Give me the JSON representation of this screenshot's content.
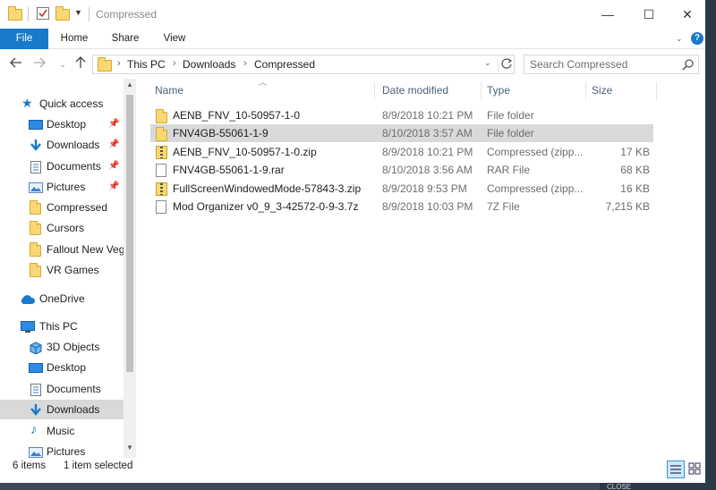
{
  "window": {
    "title": "Compressed",
    "controls": {
      "minimize": "—",
      "maximize": "☐",
      "close": "✕"
    }
  },
  "ribbon": {
    "tabs": [
      "File",
      "Home",
      "Share",
      "View"
    ],
    "help": "?"
  },
  "address": {
    "crumbs": [
      "This PC",
      "Downloads",
      "Compressed"
    ],
    "search_placeholder": "Search Compressed"
  },
  "sidebar": {
    "items": [
      {
        "label": "Quick access",
        "icon": "star-icon",
        "pinned": false
      },
      {
        "label": "Desktop",
        "icon": "desktop-icon",
        "pinned": true
      },
      {
        "label": "Downloads",
        "icon": "download-arrow-icon",
        "pinned": true
      },
      {
        "label": "Documents",
        "icon": "documents-icon",
        "pinned": true
      },
      {
        "label": "Pictures",
        "icon": "pictures-icon",
        "pinned": true
      },
      {
        "label": "Compressed",
        "icon": "folder-icon",
        "pinned": false
      },
      {
        "label": "Cursors",
        "icon": "folder-icon",
        "pinned": false
      },
      {
        "label": "Fallout New Veg",
        "icon": "folder-icon",
        "pinned": false
      },
      {
        "label": "VR Games",
        "icon": "folder-icon",
        "pinned": false
      },
      {
        "label": "OneDrive",
        "icon": "cloud-icon",
        "pinned": false
      },
      {
        "label": "This PC",
        "icon": "computer-icon",
        "pinned": false
      },
      {
        "label": "3D Objects",
        "icon": "cube-icon",
        "pinned": false
      },
      {
        "label": "Desktop",
        "icon": "desktop-icon",
        "pinned": false
      },
      {
        "label": "Documents",
        "icon": "documents-icon",
        "pinned": false
      },
      {
        "label": "Downloads",
        "icon": "download-arrow-icon",
        "pinned": false
      },
      {
        "label": "Music",
        "icon": "music-note-icon",
        "pinned": false
      },
      {
        "label": "Pictures",
        "icon": "pictures-icon",
        "pinned": false
      }
    ]
  },
  "files": {
    "columns": [
      "Name",
      "Date modified",
      "Type",
      "Size"
    ],
    "rows": [
      {
        "name": "AENB_FNV_10-50957-1-0",
        "date": "8/9/2018 10:21 PM",
        "type": "File folder",
        "size": "",
        "icon": "folder-icon"
      },
      {
        "name": "FNV4GB-55061-1-9",
        "date": "8/10/2018 3:57 AM",
        "type": "File folder",
        "size": "",
        "icon": "folder-icon"
      },
      {
        "name": "AENB_FNV_10-50957-1-0.zip",
        "date": "8/9/2018 10:21 PM",
        "type": "Compressed (zipp...",
        "size": "17 KB",
        "icon": "zip-icon"
      },
      {
        "name": "FNV4GB-55061-1-9.rar",
        "date": "8/10/2018 3:56 AM",
        "type": "RAR File",
        "size": "68 KB",
        "icon": "file-icon"
      },
      {
        "name": "FullScreenWindowedMode-57843-3.zip",
        "date": "8/9/2018 9:53 PM",
        "type": "Compressed (zipp...",
        "size": "16 KB",
        "icon": "zip-icon"
      },
      {
        "name": "Mod Organizer v0_9_3-42572-0-9-3.7z",
        "date": "8/9/2018 10:03 PM",
        "type": "7Z File",
        "size": "7,215 KB",
        "icon": "file-icon"
      }
    ]
  },
  "status": {
    "item_count": "6 items",
    "selection": "1 item selected"
  },
  "background": {
    "bottom_text": "CLOSE"
  },
  "colors": {
    "accent": "#1979ca",
    "selection": "#d9d9d9",
    "folder": "#f8d775"
  }
}
